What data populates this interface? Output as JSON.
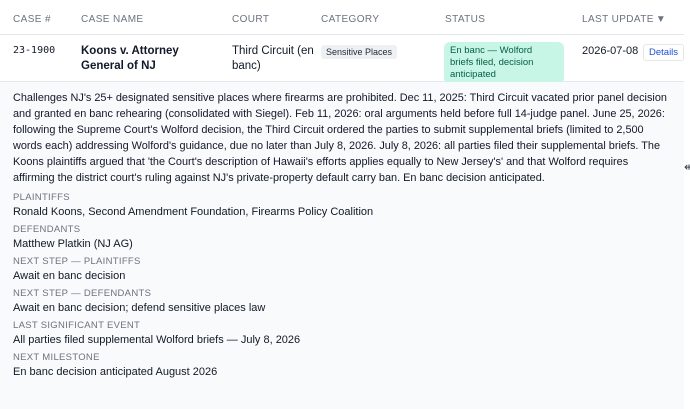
{
  "headers": {
    "case_num": "CASE #",
    "case_name": "CASE NAME",
    "court": "COURT",
    "category": "CATEGORY",
    "status": "STATUS",
    "last_update": "LAST UPDATE",
    "sort_icon": "▼"
  },
  "row": {
    "case_num": "23-1900",
    "case_name": "Koons v. Attorney General of NJ",
    "court": "Third Circuit (en banc)",
    "category": "Sensitive Places",
    "status": "En banc — Wolford briefs filed, decision anticipated",
    "last_update": "2026-07-08",
    "details_label": "Details"
  },
  "detail": {
    "summary": "Challenges NJ's 25+ designated sensitive places where firearms are prohibited. Dec 11, 2025: Third Circuit vacated prior panel decision and granted en banc rehearing (consolidated with Siegel). Feb 11, 2026: oral arguments held before full 14-judge panel. June 25, 2026: following the Supreme Court's Wolford decision, the Third Circuit ordered the parties to submit supplemental briefs (limited to 2,500 words each) addressing Wolford's guidance, due no later than July 8, 2026. July 8, 2026: all parties filed their supplemental briefs. The Koons plaintiffs argued that 'the Court's description of Hawaii's efforts applies equally to New Jersey's' and that Wolford requires affirming the district court's ruling against NJ's private-property default carry ban. En banc decision anticipated.",
    "fields": [
      {
        "label": "PLAINTIFFS",
        "value": "Ronald Koons, Second Amendment Foundation, Firearms Policy Coalition"
      },
      {
        "label": "DEFENDANTS",
        "value": "Matthew Platkin (NJ AG)"
      },
      {
        "label": "NEXT STEP — PLAINTIFFS",
        "value": "Await en banc decision"
      },
      {
        "label": "NEXT STEP — DEFENDANTS",
        "value": "Await en banc decision; defend sensitive places law"
      },
      {
        "label": "LAST SIGNIFICANT EVENT",
        "value": "All parties filed supplemental Wolford briefs — July 8, 2026"
      },
      {
        "label": "NEXT MILESTONE",
        "value": "En banc decision anticipated August 2026"
      }
    ]
  },
  "colors": {
    "status_bg": "#c7f5e6",
    "status_text": "#065f46",
    "link": "#1d4ed8",
    "detail_bg": "#f9fafb"
  },
  "icons": {
    "cursor": "resize-horizontal-cursor-icon"
  }
}
